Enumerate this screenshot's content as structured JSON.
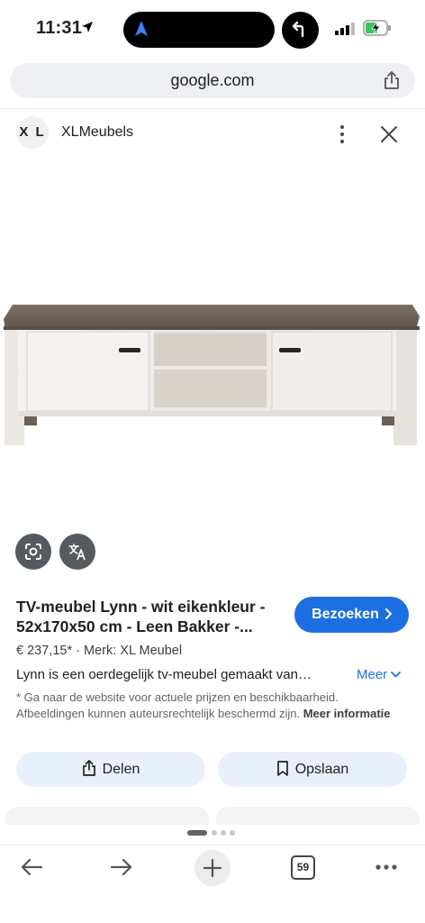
{
  "status_bar": {
    "time": "11:31",
    "icons": [
      "location-arrow-icon",
      "navigation-icon",
      "back-arrow-icon",
      "signal-icon",
      "battery-charging-icon"
    ]
  },
  "browser": {
    "url": "google.com",
    "tab_count": "59"
  },
  "site": {
    "logo_text": "X L",
    "name": "XLMeubels"
  },
  "product": {
    "title": "TV-meubel Lynn - wit eikenkleur - 52x170x50 cm - Leen Bakker -...",
    "visit_label": "Bezoeken",
    "price": "€ 237,15*",
    "separator": "·",
    "brand": "Merk: XL Meubel",
    "description": "Lynn is een oerdegelijk tv-meubel gemaakt van…",
    "more_label": "Meer",
    "disclaimer": "* Ga naar de website voor actuele prijzen en beschikbaarheid. Afbeeldingen kunnen auteursrechtelijk beschermd zijn.",
    "more_info_label": "Meer informatie",
    "share_label": "Delen",
    "save_label": "Opslaan"
  },
  "colors": {
    "accent": "#1b6fe1",
    "action_bg": "#e8f0fe",
    "url_bar_bg": "#eff0f3",
    "tabletop": "#6e6358",
    "cabinet": "#ece8e4"
  }
}
